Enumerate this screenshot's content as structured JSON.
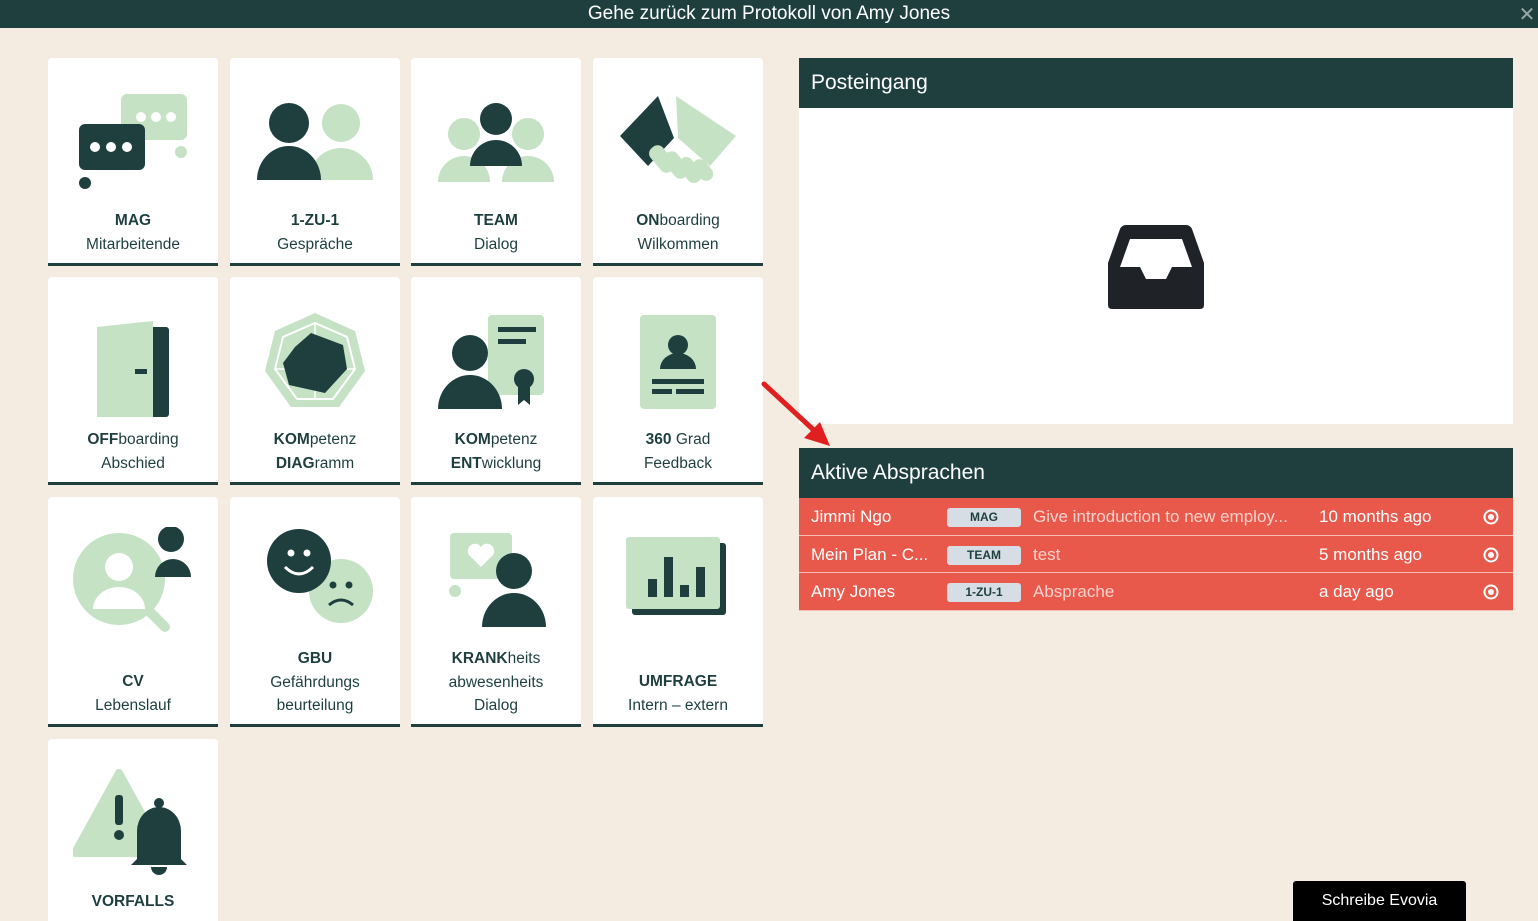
{
  "topbar": {
    "title": "Gehe zurück zum Protokoll von Amy Jones",
    "close_glyph": "✕"
  },
  "colors": {
    "dark": "#1f3f3f",
    "light_green": "#c5e2c5",
    "background": "#f5ece1",
    "alert_red": "#e8594b"
  },
  "tiles": [
    {
      "id": "mag",
      "icon": "chat-bubbles-icon",
      "line1_bold": "MAG",
      "line1_rest": "",
      "line2_bold": "",
      "line2_rest": "Mitarbeitende",
      "line3": ""
    },
    {
      "id": "1zu1",
      "icon": "two-people-icon",
      "line1_bold": "1-ZU-1",
      "line1_rest": "",
      "line2_bold": "",
      "line2_rest": "Gespräche",
      "line3": ""
    },
    {
      "id": "team",
      "icon": "team-icon",
      "line1_bold": "TEAM",
      "line1_rest": "",
      "line2_bold": "",
      "line2_rest": "Dialog",
      "line3": ""
    },
    {
      "id": "onboarding",
      "icon": "handshake-icon",
      "line1_bold": "ON",
      "line1_rest": "boarding",
      "line2_bold": "",
      "line2_rest": "Wilkommen",
      "line3": ""
    },
    {
      "id": "offboarding",
      "icon": "door-icon",
      "line1_bold": "OFF",
      "line1_rest": "boarding",
      "line2_bold": "",
      "line2_rest": "Abschied",
      "line3": ""
    },
    {
      "id": "kompdiag",
      "icon": "radar-chart-icon",
      "line1_bold": "KOM",
      "line1_rest": "petenz",
      "line2_bold": "DIAG",
      "line2_rest": "ramm",
      "line3": ""
    },
    {
      "id": "kompent",
      "icon": "certificate-person-icon",
      "line1_bold": "KOM",
      "line1_rest": "petenz",
      "line2_bold": "ENT",
      "line2_rest": "wicklung",
      "line3": ""
    },
    {
      "id": "360",
      "icon": "id-card-icon",
      "line1_bold": "360",
      "line1_rest": " Grad",
      "line2_bold": "",
      "line2_rest": "Feedback",
      "line3": ""
    },
    {
      "id": "cv",
      "icon": "person-search-icon",
      "line1_bold": "CV",
      "line1_rest": "",
      "line2_bold": "",
      "line2_rest": "Lebenslauf",
      "line3": ""
    },
    {
      "id": "gbu",
      "icon": "happy-sad-faces-icon",
      "line1_bold": "GBU",
      "line1_rest": "",
      "line2_bold": "",
      "line2_rest": "Gefährdungs",
      "line3": "beurteilung"
    },
    {
      "id": "krank",
      "icon": "heart-person-icon",
      "line1_bold": "KRANK",
      "line1_rest": "heits",
      "line2_bold": "",
      "line2_rest": "abwesenheits",
      "line3": "Dialog"
    },
    {
      "id": "umfrage",
      "icon": "bar-chart-icon",
      "line1_bold": "UMFRAGE",
      "line1_rest": "",
      "line2_bold": "",
      "line2_rest": "Intern – extern",
      "line3": ""
    },
    {
      "id": "vorfalls",
      "icon": "warning-bell-icon",
      "line1_bold": "VORFALLS",
      "line1_rest": "",
      "line2_bold": "",
      "line2_rest": "",
      "line3": ""
    }
  ],
  "inbox": {
    "title": "Posteingang",
    "empty_icon": "inbox-tray-icon"
  },
  "agreements": {
    "title": "Aktive Absprachen",
    "rows": [
      {
        "name": "Jimmi Ngo",
        "badge": "MAG",
        "text": "Give introduction to new employ...",
        "time": "10 months ago"
      },
      {
        "name": "Mein Plan - C...",
        "badge": "TEAM",
        "text": "test",
        "time": "5 months ago"
      },
      {
        "name": "Amy Jones",
        "badge": "1-ZU-1",
        "text": "Absprache",
        "time": "a day ago"
      }
    ]
  },
  "footer": {
    "write_button": "Schreibe Evovia"
  }
}
